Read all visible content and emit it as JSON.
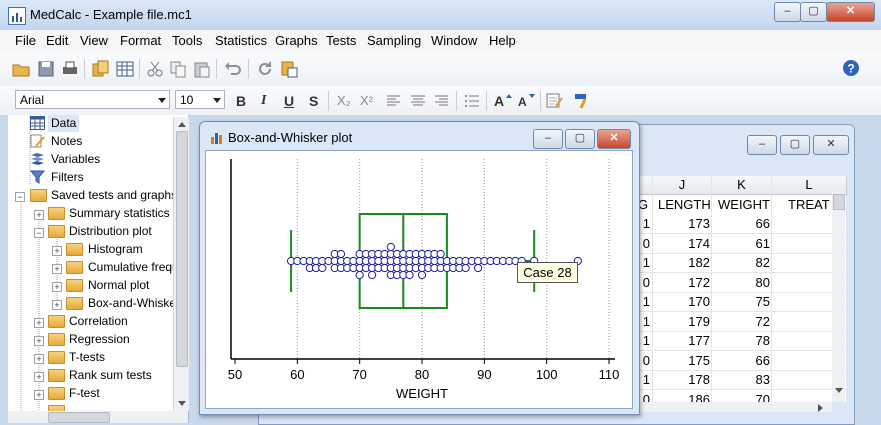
{
  "window": {
    "title": "MedCalc - Example file.mc1",
    "controls": [
      "–",
      "▢",
      "✕"
    ]
  },
  "menu": [
    "File",
    "Edit",
    "View",
    "Format",
    "Tools",
    "Statistics",
    "Graphs",
    "Tests",
    "Sampling",
    "Window",
    "Help"
  ],
  "toolbar": {
    "icons": [
      "open-icon",
      "save-icon",
      "print-icon",
      "copy-sheet-icon",
      "grid-icon",
      "cut-icon",
      "copy-icon",
      "paste-icon",
      "undo-icon",
      "redo-icon",
      "paste-special-icon",
      "help-icon"
    ]
  },
  "format_bar": {
    "font": "Arial",
    "size": "10",
    "bold": "B",
    "italic": "I",
    "underline": "U",
    "shadow": "S",
    "subscript": "X₂",
    "superscript": "X²"
  },
  "tree": {
    "items": [
      {
        "label": "Data",
        "level": 1,
        "selected": true
      },
      {
        "label": "Notes",
        "level": 1
      },
      {
        "label": "Variables",
        "level": 1
      },
      {
        "label": "Filters",
        "level": 1
      },
      {
        "label": "Saved tests and graphs",
        "level": 0
      },
      {
        "label": "Summary statistics",
        "level": 1
      },
      {
        "label": "Distribution plot",
        "level": 1
      },
      {
        "label": "Histogram",
        "level": 2
      },
      {
        "label": "Cumulative freque",
        "level": 2
      },
      {
        "label": "Normal plot",
        "level": 2
      },
      {
        "label": "Box-and-Whisker",
        "level": 2
      },
      {
        "label": "Correlation",
        "level": 1
      },
      {
        "label": "Regression",
        "level": 1
      },
      {
        "label": "T-tests",
        "level": 1
      },
      {
        "label": "Rank sum tests",
        "level": 1
      },
      {
        "label": "F-test",
        "level": 1
      }
    ]
  },
  "sheet": {
    "columns": [
      "J",
      "K",
      "L"
    ],
    "headers": [
      "G",
      "LENGTH",
      "WEIGHT",
      "TREAT"
    ],
    "rows": [
      [
        "1",
        "173",
        "66"
      ],
      [
        "0",
        "174",
        "61"
      ],
      [
        "1",
        "182",
        "82"
      ],
      [
        "0",
        "172",
        "80"
      ],
      [
        "1",
        "170",
        "75"
      ],
      [
        "1",
        "179",
        "72"
      ],
      [
        "1",
        "177",
        "78"
      ],
      [
        "0",
        "175",
        "66"
      ],
      [
        "1",
        "178",
        "83"
      ],
      [
        "0",
        "186",
        "70"
      ]
    ]
  },
  "chart_window": {
    "title": "Box-and-Whisker plot",
    "tooltip": "Case 28"
  },
  "chart_data": {
    "type": "box-and-whisker",
    "orientation": "horizontal",
    "xlabel": "WEIGHT",
    "xlim": [
      50,
      110
    ],
    "ticks": [
      50,
      60,
      70,
      80,
      90,
      100,
      110
    ],
    "grid": "dotted vertical",
    "box": {
      "whisker_low": 59,
      "q1": 70,
      "median": 77,
      "q3": 84,
      "whisker_high": 98
    },
    "points": [
      59,
      60,
      61,
      62,
      62,
      63,
      63,
      64,
      64,
      65,
      66,
      66,
      66,
      67,
      67,
      67,
      68,
      68,
      69,
      69,
      70,
      70,
      70,
      70,
      71,
      71,
      71,
      72,
      72,
      72,
      72,
      73,
      73,
      73,
      74,
      74,
      74,
      75,
      75,
      75,
      75,
      75,
      76,
      76,
      76,
      76,
      77,
      77,
      77,
      77,
      78,
      78,
      78,
      78,
      79,
      79,
      79,
      80,
      80,
      80,
      80,
      81,
      81,
      81,
      82,
      82,
      82,
      83,
      83,
      83,
      84,
      84,
      85,
      85,
      86,
      86,
      87,
      87,
      88,
      89,
      89,
      90,
      91,
      92,
      93,
      94,
      95,
      96,
      98,
      105
    ],
    "outlier_label": "Case 28",
    "colors": {
      "box": "#1a8a1a",
      "points": "#1a1aa0"
    }
  }
}
